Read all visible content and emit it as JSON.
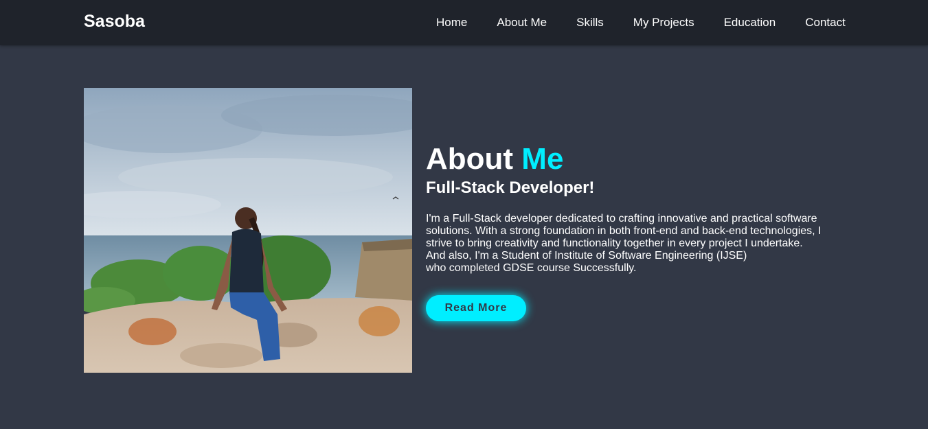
{
  "header": {
    "logo": "Sasoba",
    "nav": [
      {
        "label": "Home"
      },
      {
        "label": "About Me"
      },
      {
        "label": "Skills"
      },
      {
        "label": "My Projects"
      },
      {
        "label": "Education"
      },
      {
        "label": "Contact"
      }
    ]
  },
  "about": {
    "title_main": "About ",
    "title_accent": "Me",
    "subtitle": "Full-Stack Developer!",
    "bio_lines": [
      "I'm a Full-Stack developer dedicated to crafting innovative and practical software",
      "solutions. With a strong foundation in both front-end and back-end technologies, I",
      "strive to bring creativity and functionality together in every project I undertake.",
      "And also, I'm a Student of Institute of Software Engineering (IJSE)",
      "who completed GDSE course Successfully."
    ],
    "button_label": "Read More"
  },
  "colors": {
    "background": "#323846",
    "navbar": "#1f232b",
    "accent": "#00eeff",
    "text": "#ffffff"
  }
}
